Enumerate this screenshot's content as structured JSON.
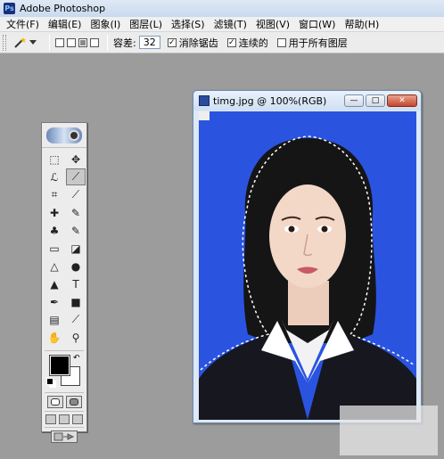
{
  "app": {
    "title": "Adobe Photoshop",
    "logo_text": "Ps"
  },
  "menu": [
    "文件(F)",
    "编辑(E)",
    "图象(I)",
    "图层(L)",
    "选择(S)",
    "滤镜(T)",
    "视图(V)",
    "窗口(W)",
    "帮助(H)"
  ],
  "options": {
    "tolerance_label": "容差:",
    "tolerance_value": "32",
    "anti_alias": {
      "label": "消除锯齿",
      "checked": true
    },
    "contiguous": {
      "label": "连续的",
      "checked": true
    },
    "use_all_layers": {
      "label": "用于所有图层",
      "checked": false
    },
    "check_mark": "✓"
  },
  "document": {
    "title": "timg.jpg @ 100%(RGB)",
    "min_glyph": "—",
    "max_glyph": "□",
    "close_glyph": "✕"
  },
  "toolbox": {
    "tools": [
      {
        "name": "marquee-icon",
        "glyph": "⬚"
      },
      {
        "name": "move-icon",
        "glyph": "✥"
      },
      {
        "name": "lasso-icon",
        "glyph": "ℒ"
      },
      {
        "name": "magic-wand-icon",
        "glyph": "⟋",
        "selected": true
      },
      {
        "name": "crop-icon",
        "glyph": "⌗"
      },
      {
        "name": "slice-icon",
        "glyph": "⟋"
      },
      {
        "name": "healing-brush-icon",
        "glyph": "✚"
      },
      {
        "name": "brush-icon",
        "glyph": "✎"
      },
      {
        "name": "clone-stamp-icon",
        "glyph": "♣"
      },
      {
        "name": "history-brush-icon",
        "glyph": "✎"
      },
      {
        "name": "eraser-icon",
        "glyph": "▭"
      },
      {
        "name": "paint-bucket-icon",
        "glyph": "◪"
      },
      {
        "name": "blur-icon",
        "glyph": "△"
      },
      {
        "name": "dodge-icon",
        "glyph": "●"
      },
      {
        "name": "path-select-icon",
        "glyph": "▲"
      },
      {
        "name": "type-icon",
        "glyph": "T"
      },
      {
        "name": "pen-icon",
        "glyph": "✒"
      },
      {
        "name": "shape-icon",
        "glyph": "■"
      },
      {
        "name": "notes-icon",
        "glyph": "▤"
      },
      {
        "name": "eyedropper-icon",
        "glyph": "⟋"
      },
      {
        "name": "hand-icon",
        "glyph": "✋"
      },
      {
        "name": "zoom-icon",
        "glyph": "⚲"
      }
    ],
    "swap_glyph": "↶"
  },
  "colors": {
    "foreground": "#000000",
    "background": "#ffffff",
    "canvas_bg": "#2a54e0"
  }
}
